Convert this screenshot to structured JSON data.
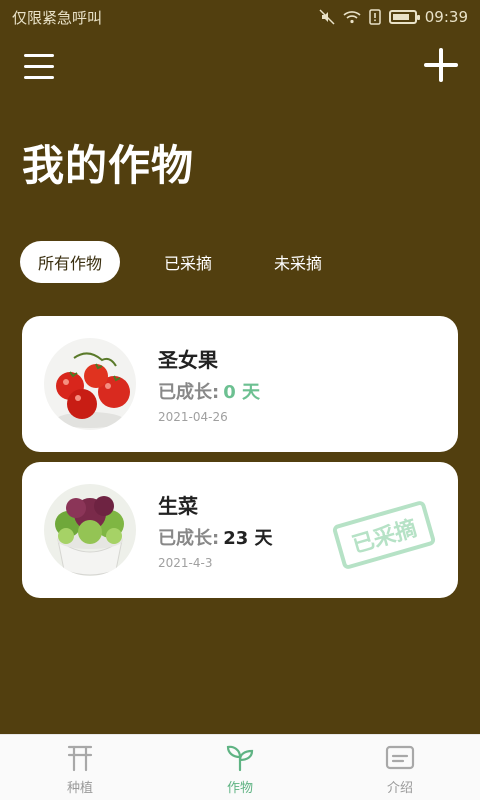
{
  "status_bar": {
    "left_text": "仅限紧急呼叫",
    "time": "09:39",
    "icons": [
      "mute-icon",
      "wifi-icon",
      "alert-icon",
      "battery-icon"
    ]
  },
  "header": {
    "title": "我的作物",
    "menu_icon": "menu-icon",
    "add_icon": "plus-icon"
  },
  "tabs": [
    {
      "label": "所有作物",
      "active": true
    },
    {
      "label": "已采摘",
      "active": false
    },
    {
      "label": "未采摘",
      "active": false
    }
  ],
  "crops": [
    {
      "name": "圣女果",
      "growth_label": "已成长:",
      "days": "0 天",
      "date": "2021-04-26",
      "harvested": false
    },
    {
      "name": "生菜",
      "growth_label": "已成长:",
      "days": "23 天",
      "date": "2021-4-3",
      "harvested": true,
      "stamp": "已采摘"
    }
  ],
  "bottom_nav": [
    {
      "label": "种植",
      "icon": "gate-icon",
      "active": false
    },
    {
      "label": "作物",
      "icon": "sprout-icon",
      "active": true
    },
    {
      "label": "介绍",
      "icon": "card-icon",
      "active": false
    }
  ],
  "colors": {
    "background": "#523f0f",
    "accent_green": "#6cc091",
    "stamp_green": "#b6e2c6",
    "nav_active": "#5fb383"
  }
}
